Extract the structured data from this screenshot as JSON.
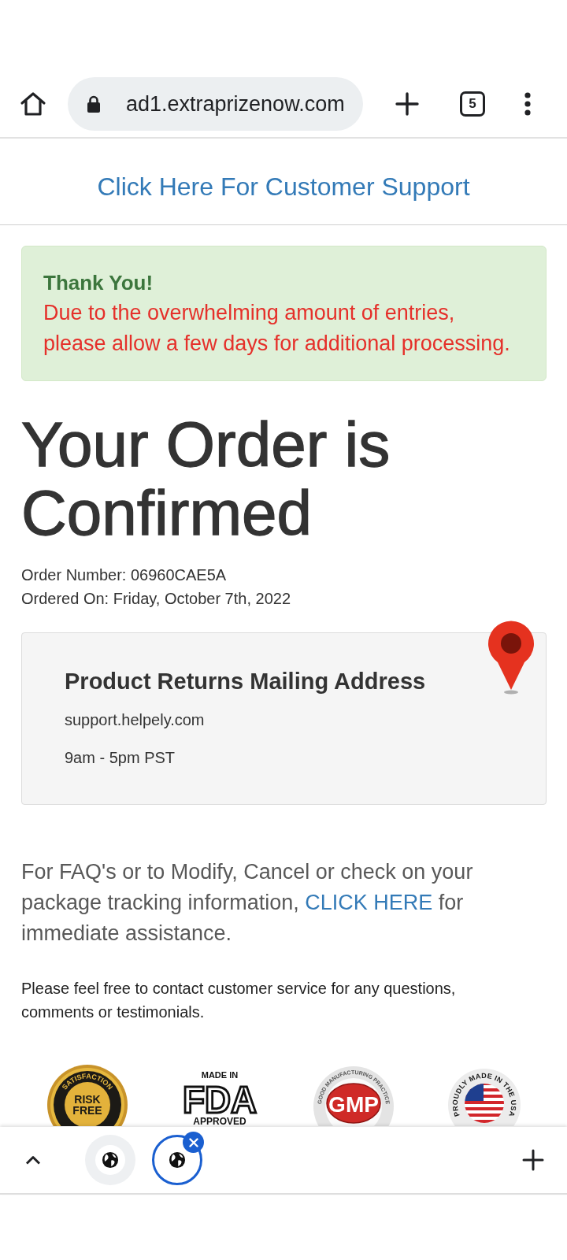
{
  "browser_toolbar": {
    "url": "ad1.extraprizenow.com",
    "tab_count": "5"
  },
  "support_link": "Click Here For Customer Support",
  "alert": {
    "title": "Thank You!",
    "message": "Due to the overwhelming amount of entries, please allow a few days for additional processing."
  },
  "heading": "Your Order is Confirmed",
  "order_info": [
    "Order Number: 06960CAE5A",
    "Ordered On: Friday, October 7th, 2022"
  ],
  "address_card": {
    "title": "Product Returns Mailing Address",
    "lines": [
      "support.helpely.com",
      "9am - 5pm PST"
    ]
  },
  "help_text": {
    "before": "For FAQ's or to Modify, Cancel or check on your package tracking information, ",
    "link": "CLICK HERE",
    "after": " for immediate assistance."
  },
  "contact_note": "Please feel free to contact customer service for any questions, comments or testimonials.",
  "badges": [
    {
      "kind": "seal",
      "arc_text": "SATISFACTION",
      "lines": [
        "RISK",
        "FREE"
      ]
    },
    {
      "kind": "fda",
      "top": "MADE IN",
      "text": "FDA",
      "bottom": "APPROVED"
    },
    {
      "kind": "gmp",
      "arc_text": "GOOD MANUFACTURING PRACTICE",
      "text": "GMP"
    },
    {
      "kind": "usa",
      "arc_text": "PROUDLY MADE IN THE USA"
    }
  ],
  "bottom_bar": {
    "tabs": [
      {
        "selected": false
      },
      {
        "selected": true
      }
    ]
  }
}
